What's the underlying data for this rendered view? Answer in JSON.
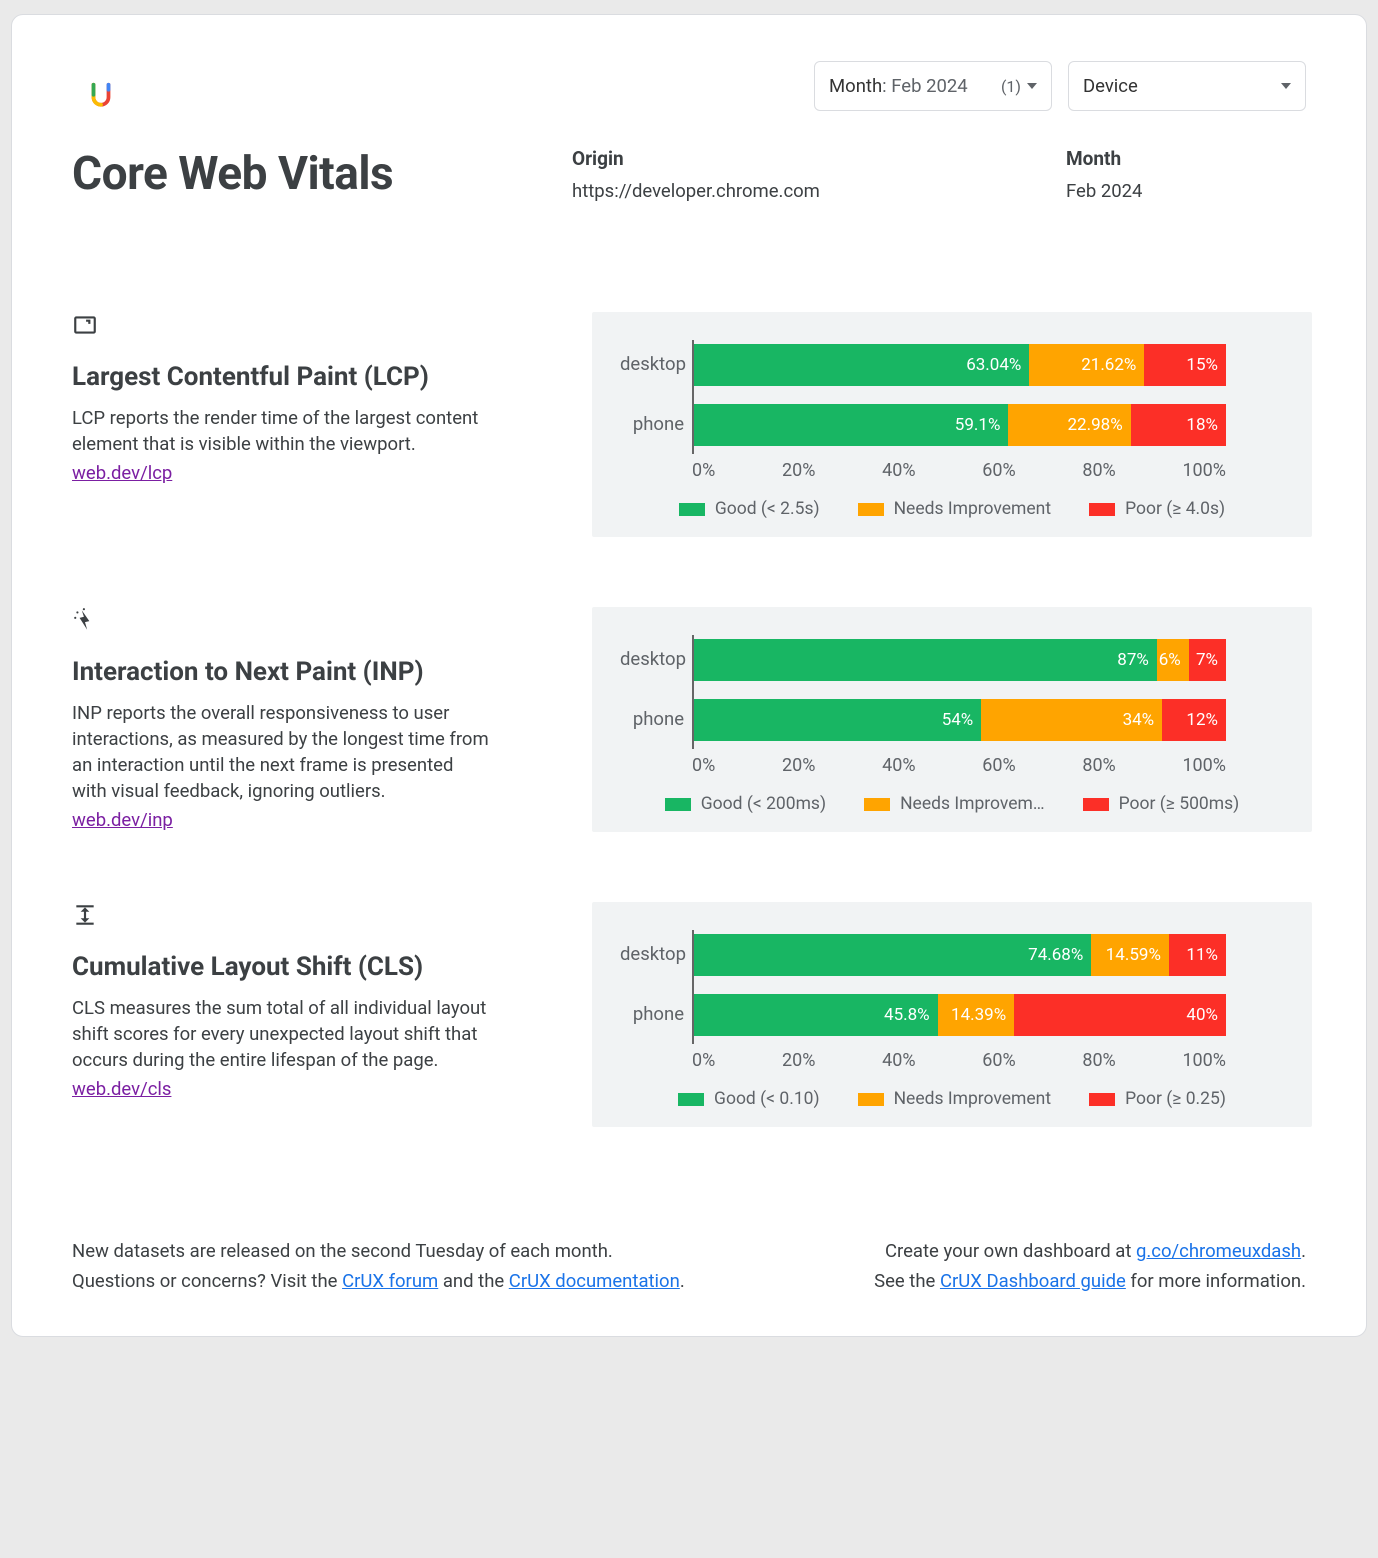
{
  "selectors": {
    "month_label": "Month",
    "month_value": ": Feb 2024",
    "month_count": "(1)",
    "device_label": "Device"
  },
  "title": "Core Web Vitals",
  "origin": {
    "label": "Origin",
    "value": "https://developer.chrome.com"
  },
  "month": {
    "label": "Month",
    "value": "Feb 2024"
  },
  "ticks": [
    "0%",
    "20%",
    "40%",
    "60%",
    "80%",
    "100%"
  ],
  "metrics": [
    {
      "icon": "lcp",
      "title": "Largest Contentful Paint (LCP)",
      "desc": "LCP reports the render time of the largest content element that is visible within the viewport.",
      "link_text": "web.dev/lcp",
      "legend": {
        "good": "Good (< 2.5s)",
        "needs": "Needs Improvement",
        "poor": "Poor (≥ 4.0s)"
      }
    },
    {
      "icon": "inp",
      "title": "Interaction to Next Paint (INP)",
      "desc": "INP reports the overall responsiveness to user interactions, as measured by the longest time from an interaction until the next frame is presented with visual feedback, ignoring outliers.",
      "link_text": "web.dev/inp",
      "legend": {
        "good": "Good (< 200ms)",
        "needs": "Needs Improvement (Needs Improvem…)",
        "poor": "Poor (≥ 500ms)"
      },
      "legend_needs_display": "Needs Improvem…"
    },
    {
      "icon": "cls",
      "title": "Cumulative Layout Shift (CLS)",
      "desc": "CLS measures the sum total of all individual layout shift scores for every unexpected layout shift that occurs during the entire lifespan of the page.",
      "link_text": "web.dev/cls",
      "legend": {
        "good": "Good (< 0.10)",
        "needs": "Needs Improvement",
        "poor": "Poor (≥ 0.25)"
      }
    }
  ],
  "chart_data": [
    {
      "type": "bar",
      "title": "Largest Contentful Paint (LCP)",
      "categories": [
        "desktop",
        "phone"
      ],
      "series": [
        {
          "name": "Good (< 2.5s)",
          "values": [
            63.04,
            59.1
          ],
          "labels": [
            "63.04%",
            "59.1%"
          ]
        },
        {
          "name": "Needs Improvement",
          "values": [
            21.62,
            22.98
          ],
          "labels": [
            "21.62%",
            "22.98%"
          ]
        },
        {
          "name": "Poor (≥ 4.0s)",
          "values": [
            15.34,
            17.92
          ],
          "labels": [
            "15%",
            "18%"
          ]
        }
      ],
      "xlim": [
        0,
        100
      ],
      "xlabel": "",
      "ylabel": ""
    },
    {
      "type": "bar",
      "title": "Interaction to Next Paint (INP)",
      "categories": [
        "desktop",
        "phone"
      ],
      "series": [
        {
          "name": "Good (< 200ms)",
          "values": [
            87,
            54
          ],
          "labels": [
            "87%",
            "54%"
          ]
        },
        {
          "name": "Needs Improvement",
          "values": [
            6,
            34
          ],
          "labels": [
            "6%",
            "34%"
          ]
        },
        {
          "name": "Poor (≥ 500ms)",
          "values": [
            7,
            12
          ],
          "labels": [
            "7%",
            "12%"
          ]
        }
      ],
      "xlim": [
        0,
        100
      ]
    },
    {
      "type": "bar",
      "title": "Cumulative Layout Shift (CLS)",
      "categories": [
        "desktop",
        "phone"
      ],
      "series": [
        {
          "name": "Good (< 0.10)",
          "values": [
            74.68,
            45.8
          ],
          "labels": [
            "74.68%",
            "45.8%"
          ]
        },
        {
          "name": "Needs Improvement",
          "values": [
            14.59,
            14.39
          ],
          "labels": [
            "14.59%",
            "14.39%"
          ]
        },
        {
          "name": "Poor (≥ 0.25)",
          "values": [
            10.73,
            39.81
          ],
          "labels": [
            "11%",
            "40%"
          ]
        }
      ],
      "xlim": [
        0,
        100
      ]
    }
  ],
  "footer": {
    "left_line1_a": "New datasets are released on the second Tuesday of each month.",
    "left_line2_a": "Questions or concerns? Visit the ",
    "left_link1": "CrUX forum",
    "left_line2_b": " and the ",
    "left_link2": "CrUX documentation",
    "left_line2_c": ".",
    "right_line1_a": "Create your own dashboard at ",
    "right_link1": "g.co/chromeuxdash",
    "right_line1_b": ".",
    "right_line2_a": "See the ",
    "right_link2": "CrUX Dashboard guide",
    "right_line2_b": " for more information."
  }
}
